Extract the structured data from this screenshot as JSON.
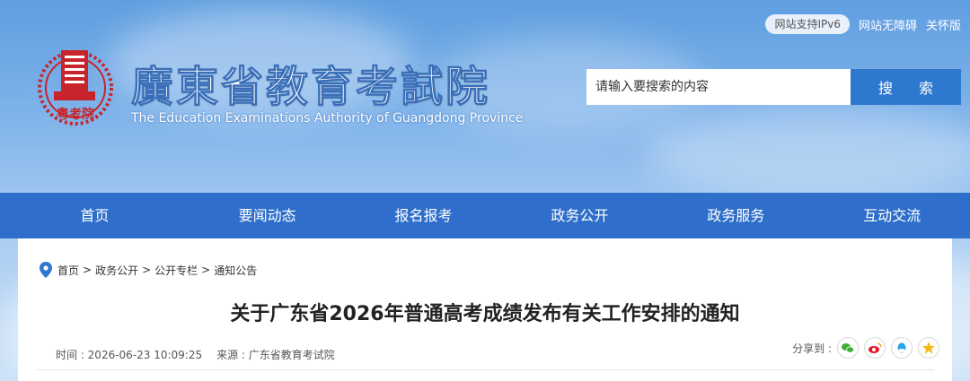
{
  "header": {
    "ipv6_badge": "网站支持IPv6",
    "accessibility_link": "网站无障碍",
    "care_link": "关怀版",
    "site_title": "廣東省教育考試院",
    "site_subtitle": "The Education Examinations Authority of Guangdong Province",
    "logo_seal_text": "粤考院",
    "search": {
      "placeholder": "请输入要搜索的内容",
      "button_label": "搜 索"
    }
  },
  "nav": {
    "items": [
      {
        "label": "首页"
      },
      {
        "label": "要闻动态"
      },
      {
        "label": "报名报考"
      },
      {
        "label": "政务公开"
      },
      {
        "label": "政务服务"
      },
      {
        "label": "互动交流"
      }
    ]
  },
  "breadcrumb": {
    "items": [
      "首页",
      "政务公开",
      "公开专栏",
      "通知公告"
    ],
    "separator": ">"
  },
  "article": {
    "title": "关于广东省2026年普通高考成绩发布有关工作安排的通知",
    "time": "时间 : 2026-06-23 10:09:25",
    "source": "来源 : 广东省教育考试院"
  },
  "share": {
    "label": "分享到 :",
    "icons": [
      "wechat-icon",
      "weibo-icon",
      "qq-icon",
      "qzone-icon"
    ]
  },
  "colors": {
    "nav_bg": "#2f6fcb",
    "search_btn": "#2f78d0",
    "logo_red": "#c8242b"
  }
}
